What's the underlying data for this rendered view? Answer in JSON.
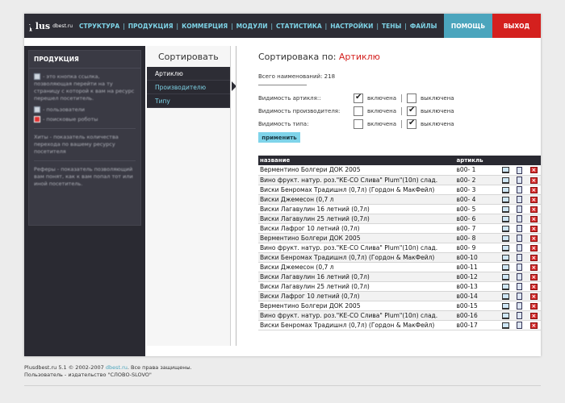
{
  "header": {
    "logo_text": "plus",
    "logo_sub": "dbest.ru",
    "nav": [
      "СТРУКТУРА",
      "ПРОДУКЦИЯ",
      "КОММЕРЦИЯ",
      "МОДУЛИ",
      "СТАТИСТИКА",
      "НАСТРОЙКИ",
      "ТЕНЫ",
      "ФАЙЛЫ"
    ],
    "help_label": "ПОМОЩЬ",
    "exit_label": "ВЫХОД"
  },
  "left_panel": {
    "title": "ПРОДУКЦИЯ",
    "text1": "- это кнопка ссылка, позволяющая перейти на ту страницу с которой к вам на ресурс перешел посетитель.",
    "users_label": "- пользователи",
    "robots_label": "- поисковые роботы",
    "hits_text": "Хиты - показатель количества перехода по вашему ресурсу посетителя",
    "referer_text": "Реферы - показатель позволяющий вам понят, как к вам попал тот или иной посетитель."
  },
  "sort_panel": {
    "title": "Сортировать",
    "items": [
      "Артиклю",
      "Производителю",
      "Типу"
    ]
  },
  "main": {
    "title_prefix": "Сортировака по:",
    "title_value": "Артиклю",
    "total": "Всего наименований: 218",
    "visibility": [
      {
        "label": "Видимость артикля::",
        "on_label": "включена",
        "off_label": "выключена",
        "on": true
      },
      {
        "label": "Видимость производителя:",
        "on_label": "включена",
        "off_label": "выключена",
        "on": false
      },
      {
        "label": "Видимость типа:",
        "on_label": "включена",
        "off_label": "выключена",
        "on": false
      }
    ],
    "apply_label": "применить",
    "table": {
      "headers": [
        "название",
        "артикль"
      ],
      "rows": [
        [
          "Верментино Болгери ДОК 2005",
          "в00- 1"
        ],
        [
          "Вино фрукт. натур. роз.\"КЕ-СО Слива\" Plum\"(10п) слад.",
          "в00- 2"
        ],
        [
          "Виски Бенромах Традишнл (0,7л) (Гордон & МакФейл)",
          "в00- 3"
        ],
        [
          "Виски Джемесон   (0,7 л",
          "в00- 4"
        ],
        [
          "Виски Лагавулин 16 летний (0,7л)",
          "в00- 5"
        ],
        [
          "Виски Лагавулин 25 летний (0,7л)",
          "в00- 6"
        ],
        [
          "Виски Лафрог 10 летний (0,7л)",
          "в00- 7"
        ],
        [
          "Верментино Болгери ДОК 2005",
          "в00- 8"
        ],
        [
          "Вино фрукт. натур. роз.\"КЕ-СО Слива\" Plum\"(10п) слад.",
          "в00- 9"
        ],
        [
          "Виски Бенромах Традишнл (0,7л) (Гордон & МакФейл)",
          "в00-10"
        ],
        [
          "Виски Джемесон   (0,7 л",
          "в00-11"
        ],
        [
          "Виски Лагавулин 16 летний (0,7л)",
          "в00-12"
        ],
        [
          "Виски Лагавулин 25 летний (0,7л)",
          "в00-13"
        ],
        [
          "Виски Лафрог 10 летний (0,7л)",
          "в00-14"
        ],
        [
          "Верментино Болгери ДОК 2005",
          "в00-15"
        ],
        [
          "Вино фрукт. натур. роз.\"КЕ-СО Слива\" Plum\"(10п) слад.",
          "в00-16"
        ],
        [
          "Виски Бенромах Традишнл (0,7л) (Гордон & МакФейл)",
          "в00-17"
        ]
      ]
    }
  },
  "footer": {
    "line1_prefix": "Plusdbest.ru  5.1  © 2002-2007",
    "line1_link": "dbest.ru",
    "line1_suffix": ". Все права защищены.",
    "line2": "Пользователь - издательство \"СЛОВО-SLOVO\""
  },
  "colors": {
    "accent": "#7ed3e6",
    "help": "#4ba5bd",
    "exit": "#d4201e",
    "dark": "#2d2d35"
  }
}
